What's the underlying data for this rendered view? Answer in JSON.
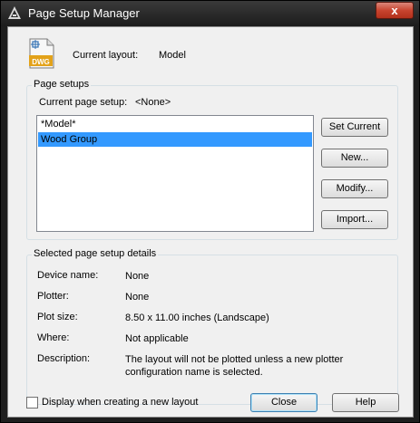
{
  "window": {
    "title": "Page Setup Manager",
    "close_glyph": "x"
  },
  "current_layout": {
    "label": "Current layout:",
    "value": "Model",
    "icon_text": "DWG"
  },
  "page_setups": {
    "group_title": "Page setups",
    "current_label": "Current page setup:",
    "current_value": "<None>",
    "items": [
      {
        "label": "*Model*",
        "selected": false
      },
      {
        "label": "Wood Group",
        "selected": true
      }
    ],
    "buttons": {
      "set_current": "Set Current",
      "new": "New...",
      "modify": "Modify...",
      "import": "Import..."
    }
  },
  "details": {
    "group_title": "Selected page setup details",
    "device_name_label": "Device name:",
    "device_name_value": "None",
    "plotter_label": "Plotter:",
    "plotter_value": "None",
    "plot_size_label": "Plot size:",
    "plot_size_value": "8.50 x 11.00 inches (Landscape)",
    "where_label": "Where:",
    "where_value": "Not applicable",
    "description_label": "Description:",
    "description_value": "The layout will not be plotted unless a new plotter configuration name is selected."
  },
  "footer": {
    "display_checkbox_label": "Display when creating a new layout",
    "display_checked": false,
    "close_label": "Close",
    "help_label": "Help"
  },
  "colors": {
    "selection": "#3399ff",
    "titlebar": "#1c1c1c",
    "close_button": "#c8442f"
  }
}
